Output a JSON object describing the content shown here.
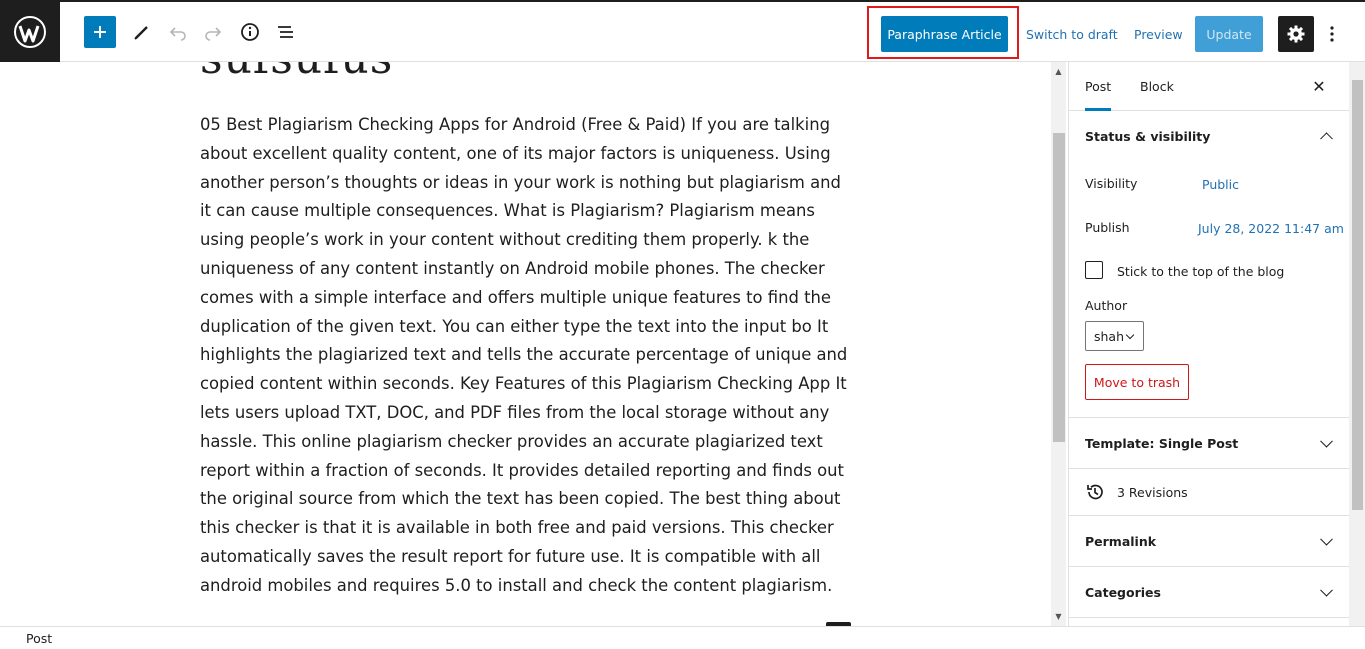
{
  "toolbar": {
    "paraphrase_label": "Paraphrase Article",
    "switch_draft_label": "Switch to draft",
    "preview_label": "Preview",
    "update_label": "Update"
  },
  "editor": {
    "title_fragment": "sufsufus",
    "paragraph": "05 Best Plagiarism Checking Apps for Android (Free & Paid) If you are talking about excellent quality content, one of its major factors is uniqueness. Using another person’s thoughts or ideas in your work is nothing but plagiarism and it can cause multiple consequences. What is Plagiarism? Plagiarism means using people’s work in your content without crediting them properly. k the uniqueness of any content instantly on Android mobile phones. The checker comes with a simple interface and offers multiple unique features to find the duplication of the given text. You can either type the text into the input bo It highlights the plagiarized text and tells the accurate percentage of unique and copied content within seconds. Key Features of this Plagiarism Checking App It lets users upload TXT, DOC, and PDF files from the local storage without any hassle. This online plagiarism checker provides an accurate plagiarized text report within a fraction of seconds. It provides detailed reporting and finds out the original source from which the text has been copied. The best thing about this checker is that it is available in both free and paid versions. This checker automatically saves the result report for future use. It is compatible with all android mobiles and requires 5.0 to install and check the content plagiarism."
  },
  "sidebar": {
    "tabs": [
      {
        "label": "Post"
      },
      {
        "label": "Block"
      }
    ],
    "status_panel": {
      "title": "Status & visibility",
      "visibility_label": "Visibility",
      "visibility_value": "Public",
      "publish_label": "Publish",
      "publish_value": "July 28, 2022 11:47 am",
      "sticky_label": "Stick to the top of the blog",
      "author_label": "Author",
      "author_value": "shah",
      "trash_label": "Move to trash"
    },
    "template_panel": {
      "title": "Template: Single Post"
    },
    "revisions": {
      "label": "3 Revisions"
    },
    "permalink_panel": {
      "title": "Permalink"
    },
    "categories_panel": {
      "title": "Categories"
    }
  },
  "footer": {
    "breadcrumb": "Post"
  }
}
